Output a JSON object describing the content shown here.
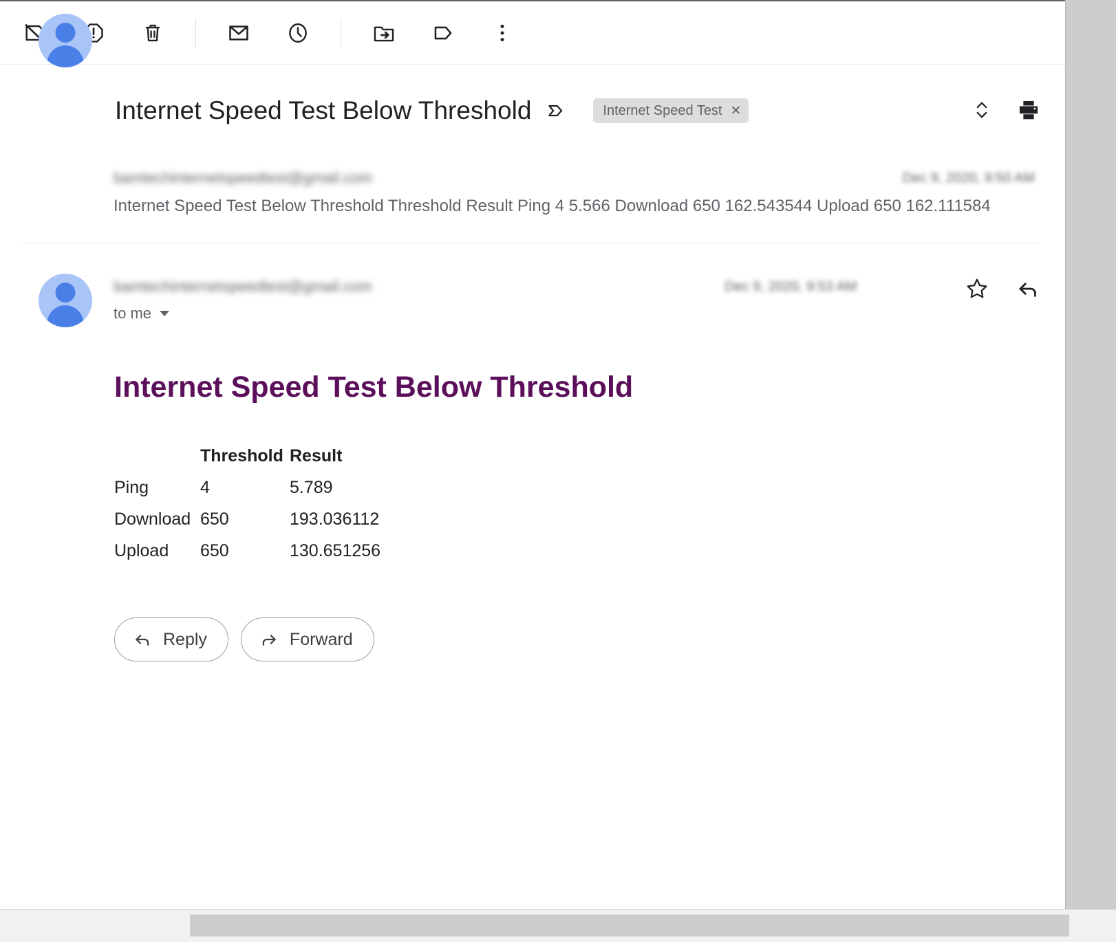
{
  "toolbar": {
    "buttons": [
      {
        "name": "archive-icon",
        "label": "Archive"
      },
      {
        "name": "report-spam-icon",
        "label": "Report spam"
      },
      {
        "name": "delete-icon",
        "label": "Delete"
      },
      {
        "name": "mark-unread-icon",
        "label": "Mark as unread"
      },
      {
        "name": "snooze-clock-icon",
        "label": "Snooze"
      },
      {
        "name": "move-to-folder-icon",
        "label": "Move to"
      },
      {
        "name": "label-tag-icon",
        "label": "Labels"
      },
      {
        "name": "more-options-icon",
        "label": "More"
      }
    ]
  },
  "header": {
    "subject": "Internet Speed Test Below Threshold",
    "inbox_icon": "label-inbox-icon",
    "label_chip": {
      "text": "Internet Speed Test",
      "remove": "✕"
    },
    "expand_icon": "expand-collapse-icon",
    "print_icon": "print-icon"
  },
  "messages": [
    {
      "sender": "bamtechinternetspeedtest@gmail.com",
      "date": "Dec 9, 2020, 9:50 AM",
      "snippet": "Internet Speed Test Below Threshold Threshold Result Ping 4 5.566 Download 650 162.543544 Upload 650 162.111584",
      "star_icon": "star-outline-icon",
      "state": "collapsed"
    },
    {
      "sender": "bamtechinternetspeedtest@gmail.com",
      "date": "Dec 9, 2020, 9:53 AM",
      "recipient": "to me",
      "star_icon": "star-outline-icon",
      "reply_icon": "reply-arrow-icon",
      "more_icon": "more-options-icon",
      "state": "expanded"
    }
  ],
  "body": {
    "heading": "Internet Speed Test Below Threshold",
    "heading_color": "#5b0f5b",
    "table": {
      "columns": [
        "",
        "Threshold",
        "Result"
      ],
      "rows": [
        {
          "metric": "Ping",
          "threshold": "4",
          "result": "5.789"
        },
        {
          "metric": "Download",
          "threshold": "650",
          "result": "193.036112"
        },
        {
          "metric": "Upload",
          "threshold": "650",
          "result": "130.651256"
        }
      ]
    }
  },
  "actions": {
    "reply": "Reply",
    "forward": "Forward"
  }
}
